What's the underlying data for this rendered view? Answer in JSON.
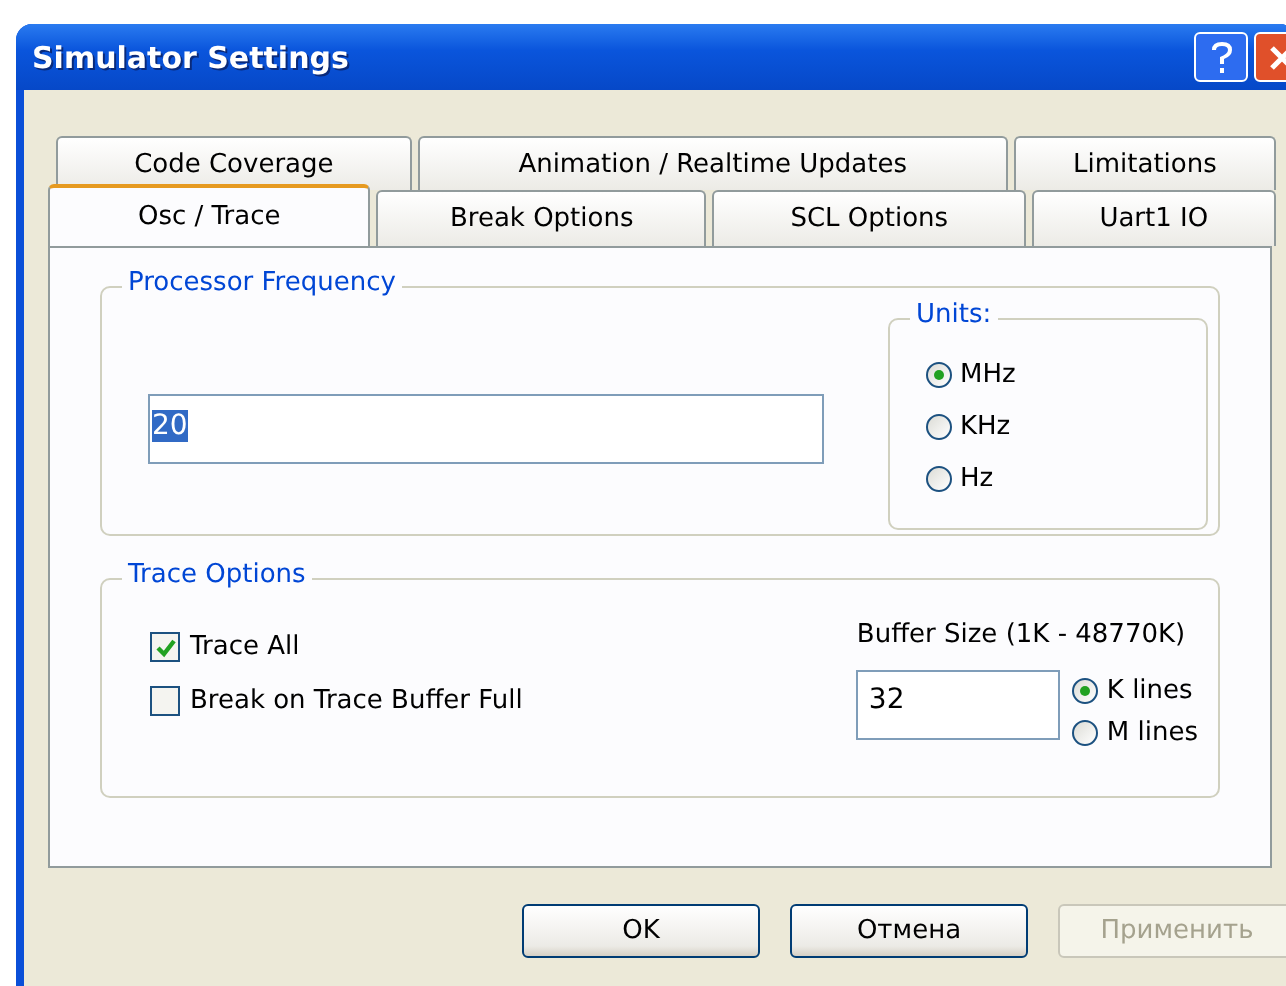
{
  "window": {
    "title": "Simulator Settings"
  },
  "tab_rows": [
    [
      {
        "label": "Code Coverage",
        "selected": false
      },
      {
        "label": "Animation / Realtime  Updates",
        "selected": false
      },
      {
        "label": "Limitations",
        "selected": false
      }
    ],
    [
      {
        "label": "Osc / Trace",
        "selected": true
      },
      {
        "label": "Break Options",
        "selected": false
      },
      {
        "label": "SCL Options",
        "selected": false
      },
      {
        "label": "Uart1  IO",
        "selected": false
      }
    ]
  ],
  "processor_frequency": {
    "title": "Processor  Frequency",
    "value": "20",
    "units": {
      "title": "Units:",
      "options": [
        {
          "label": "MHz",
          "selected": true
        },
        {
          "label": "KHz",
          "selected": false
        },
        {
          "label": "Hz",
          "selected": false
        }
      ]
    }
  },
  "trace_options": {
    "title": "Trace Options",
    "checkboxes": [
      {
        "label": "Trace All",
        "checked": true
      },
      {
        "label": "Break on Trace Buffer Full",
        "checked": false
      }
    ],
    "buffer_size": {
      "label": "Buffer Size  (1K - 48770K)",
      "value": "32",
      "options": [
        {
          "label": "K lines",
          "selected": true
        },
        {
          "label": "M lines",
          "selected": false
        }
      ]
    }
  },
  "buttons": [
    {
      "label": "OK",
      "disabled": false
    },
    {
      "label": "Отмена",
      "disabled": false
    },
    {
      "label": "Применить",
      "disabled": true
    }
  ]
}
